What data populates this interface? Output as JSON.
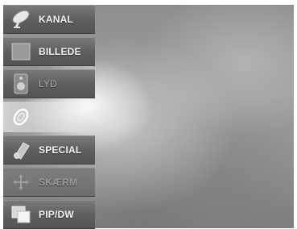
{
  "menu": {
    "items": [
      {
        "label": "KANAL",
        "icon": "satellite-dish-icon"
      },
      {
        "label": "BILLEDE",
        "icon": "picture-icon"
      },
      {
        "label": "LYD",
        "icon": "speaker-icon"
      },
      {
        "label": "",
        "icon": "disc-icon"
      },
      {
        "label": "SPECIAL",
        "icon": "tag-icon"
      },
      {
        "label": "SKÆRM",
        "icon": "arrows-icon"
      },
      {
        "label": "PIP/DW",
        "icon": "pip-icon"
      }
    ]
  }
}
